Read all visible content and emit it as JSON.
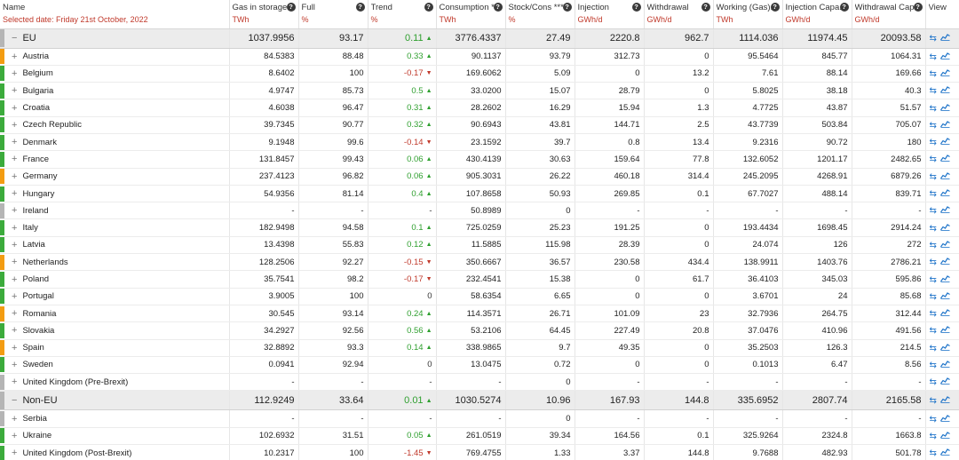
{
  "header": {
    "name_title": "Name",
    "selected_date": "Selected date: Friday 21st October, 2022",
    "help_glyph": "?",
    "columns": [
      {
        "key": "gas",
        "title": "Gas in storage",
        "unit": "TWh"
      },
      {
        "key": "full",
        "title": "Full",
        "unit": "%"
      },
      {
        "key": "trend",
        "title": "Trend",
        "unit": "%"
      },
      {
        "key": "cons",
        "title": "Consumption **",
        "unit": "TWh"
      },
      {
        "key": "stock",
        "title": "Stock/Cons ***",
        "unit": "%"
      },
      {
        "key": "inj",
        "title": "Injection",
        "unit": "GWh/d"
      },
      {
        "key": "wd",
        "title": "Withdrawal",
        "unit": "GWh/d"
      },
      {
        "key": "work",
        "title": "Working (Gas)...",
        "unit": "TWh"
      },
      {
        "key": "injc",
        "title": "Injection Capa...",
        "unit": "GWh/d"
      },
      {
        "key": "wdc",
        "title": "Withdrawal Cap...",
        "unit": "GWh/d"
      }
    ],
    "view_title": "View"
  },
  "icons": {
    "expand_collapsed": "+",
    "expand_open": "−",
    "trend_up": "▲",
    "trend_down": "▼",
    "map_view": "⇆",
    "chart_view": "📈"
  },
  "colors": {
    "green": "#3cab3c",
    "orange": "#f39c12",
    "gray": "#b5b5b5",
    "trend_up": "#2e9f2e",
    "trend_down": "#c0392b"
  },
  "rows": [
    {
      "type": "group",
      "name": "EU",
      "bar": "gray",
      "gas": "1037.9956",
      "full": "93.17",
      "trend": "0.11",
      "dir": "up",
      "cons": "3776.4337",
      "stock": "27.49",
      "inj": "2220.8",
      "wd": "962.7",
      "work": "1114.036",
      "injc": "11974.45",
      "wdc": "20093.58"
    },
    {
      "type": "country",
      "name": "Austria",
      "bar": "orange",
      "gas": "84.5383",
      "full": "88.48",
      "trend": "0.33",
      "dir": "up",
      "cons": "90.1137",
      "stock": "93.79",
      "inj": "312.73",
      "wd": "0",
      "work": "95.5464",
      "injc": "845.77",
      "wdc": "1064.31"
    },
    {
      "type": "country",
      "name": "Belgium",
      "bar": "green",
      "gas": "8.6402",
      "full": "100",
      "trend": "-0.17",
      "dir": "down",
      "cons": "169.6062",
      "stock": "5.09",
      "inj": "0",
      "wd": "13.2",
      "work": "7.61",
      "injc": "88.14",
      "wdc": "169.66"
    },
    {
      "type": "country",
      "name": "Bulgaria",
      "bar": "green",
      "gas": "4.9747",
      "full": "85.73",
      "trend": "0.5",
      "dir": "up",
      "cons": "33.0200",
      "stock": "15.07",
      "inj": "28.79",
      "wd": "0",
      "work": "5.8025",
      "injc": "38.18",
      "wdc": "40.3"
    },
    {
      "type": "country",
      "name": "Croatia",
      "bar": "green",
      "gas": "4.6038",
      "full": "96.47",
      "trend": "0.31",
      "dir": "up",
      "cons": "28.2602",
      "stock": "16.29",
      "inj": "15.94",
      "wd": "1.3",
      "work": "4.7725",
      "injc": "43.87",
      "wdc": "51.57"
    },
    {
      "type": "country",
      "name": "Czech Republic",
      "bar": "green",
      "gas": "39.7345",
      "full": "90.77",
      "trend": "0.32",
      "dir": "up",
      "cons": "90.6943",
      "stock": "43.81",
      "inj": "144.71",
      "wd": "2.5",
      "work": "43.7739",
      "injc": "503.84",
      "wdc": "705.07"
    },
    {
      "type": "country",
      "name": "Denmark",
      "bar": "green",
      "gas": "9.1948",
      "full": "99.6",
      "trend": "-0.14",
      "dir": "down",
      "cons": "23.1592",
      "stock": "39.7",
      "inj": "0.8",
      "wd": "13.4",
      "work": "9.2316",
      "injc": "90.72",
      "wdc": "180"
    },
    {
      "type": "country",
      "name": "France",
      "bar": "green",
      "gas": "131.8457",
      "full": "99.43",
      "trend": "0.06",
      "dir": "up",
      "cons": "430.4139",
      "stock": "30.63",
      "inj": "159.64",
      "wd": "77.8",
      "work": "132.6052",
      "injc": "1201.17",
      "wdc": "2482.65"
    },
    {
      "type": "country",
      "name": "Germany",
      "bar": "orange",
      "gas": "237.4123",
      "full": "96.82",
      "trend": "0.06",
      "dir": "up",
      "cons": "905.3031",
      "stock": "26.22",
      "inj": "460.18",
      "wd": "314.4",
      "work": "245.2095",
      "injc": "4268.91",
      "wdc": "6879.26"
    },
    {
      "type": "country",
      "name": "Hungary",
      "bar": "green",
      "gas": "54.9356",
      "full": "81.14",
      "trend": "0.4",
      "dir": "up",
      "cons": "107.8658",
      "stock": "50.93",
      "inj": "269.85",
      "wd": "0.1",
      "work": "67.7027",
      "injc": "488.14",
      "wdc": "839.71"
    },
    {
      "type": "country",
      "name": "Ireland",
      "bar": "gray",
      "gas": "-",
      "full": "-",
      "trend": "-",
      "dir": "none",
      "cons": "50.8989",
      "stock": "0",
      "inj": "-",
      "wd": "-",
      "work": "-",
      "injc": "-",
      "wdc": "-"
    },
    {
      "type": "country",
      "name": "Italy",
      "bar": "green",
      "gas": "182.9498",
      "full": "94.58",
      "trend": "0.1",
      "dir": "up",
      "cons": "725.0259",
      "stock": "25.23",
      "inj": "191.25",
      "wd": "0",
      "work": "193.4434",
      "injc": "1698.45",
      "wdc": "2914.24"
    },
    {
      "type": "country",
      "name": "Latvia",
      "bar": "green",
      "gas": "13.4398",
      "full": "55.83",
      "trend": "0.12",
      "dir": "up",
      "cons": "11.5885",
      "stock": "115.98",
      "inj": "28.39",
      "wd": "0",
      "work": "24.074",
      "injc": "126",
      "wdc": "272"
    },
    {
      "type": "country",
      "name": "Netherlands",
      "bar": "orange",
      "gas": "128.2506",
      "full": "92.27",
      "trend": "-0.15",
      "dir": "down",
      "cons": "350.6667",
      "stock": "36.57",
      "inj": "230.58",
      "wd": "434.4",
      "work": "138.9911",
      "injc": "1403.76",
      "wdc": "2786.21"
    },
    {
      "type": "country",
      "name": "Poland",
      "bar": "green",
      "gas": "35.7541",
      "full": "98.2",
      "trend": "-0.17",
      "dir": "down",
      "cons": "232.4541",
      "stock": "15.38",
      "inj": "0",
      "wd": "61.7",
      "work": "36.4103",
      "injc": "345.03",
      "wdc": "595.86"
    },
    {
      "type": "country",
      "name": "Portugal",
      "bar": "green",
      "gas": "3.9005",
      "full": "100",
      "trend": "0",
      "dir": "none",
      "cons": "58.6354",
      "stock": "6.65",
      "inj": "0",
      "wd": "0",
      "work": "3.6701",
      "injc": "24",
      "wdc": "85.68"
    },
    {
      "type": "country",
      "name": "Romania",
      "bar": "orange",
      "gas": "30.545",
      "full": "93.14",
      "trend": "0.24",
      "dir": "up",
      "cons": "114.3571",
      "stock": "26.71",
      "inj": "101.09",
      "wd": "23",
      "work": "32.7936",
      "injc": "264.75",
      "wdc": "312.44"
    },
    {
      "type": "country",
      "name": "Slovakia",
      "bar": "green",
      "gas": "34.2927",
      "full": "92.56",
      "trend": "0.56",
      "dir": "up",
      "cons": "53.2106",
      "stock": "64.45",
      "inj": "227.49",
      "wd": "20.8",
      "work": "37.0476",
      "injc": "410.96",
      "wdc": "491.56"
    },
    {
      "type": "country",
      "name": "Spain",
      "bar": "orange",
      "gas": "32.8892",
      "full": "93.3",
      "trend": "0.14",
      "dir": "up",
      "cons": "338.9865",
      "stock": "9.7",
      "inj": "49.35",
      "wd": "0",
      "work": "35.2503",
      "injc": "126.3",
      "wdc": "214.5"
    },
    {
      "type": "country",
      "name": "Sweden",
      "bar": "green",
      "gas": "0.0941",
      "full": "92.94",
      "trend": "0",
      "dir": "none",
      "cons": "13.0475",
      "stock": "0.72",
      "inj": "0",
      "wd": "0",
      "work": "0.1013",
      "injc": "6.47",
      "wdc": "8.56"
    },
    {
      "type": "country",
      "name": "United Kingdom (Pre-Brexit)",
      "bar": "gray",
      "gas": "-",
      "full": "-",
      "trend": "-",
      "dir": "none",
      "cons": "-",
      "stock": "0",
      "inj": "-",
      "wd": "-",
      "work": "-",
      "injc": "-",
      "wdc": "-"
    },
    {
      "type": "group",
      "name": "Non-EU",
      "bar": "gray",
      "gas": "112.9249",
      "full": "33.64",
      "trend": "0.01",
      "dir": "up",
      "cons": "1030.5274",
      "stock": "10.96",
      "inj": "167.93",
      "wd": "144.8",
      "work": "335.6952",
      "injc": "2807.74",
      "wdc": "2165.58"
    },
    {
      "type": "country",
      "name": "Serbia",
      "bar": "gray",
      "gas": "-",
      "full": "-",
      "trend": "-",
      "dir": "none",
      "cons": "-",
      "stock": "0",
      "inj": "-",
      "wd": "-",
      "work": "-",
      "injc": "-",
      "wdc": "-"
    },
    {
      "type": "country",
      "name": "Ukraine",
      "bar": "green",
      "gas": "102.6932",
      "full": "31.51",
      "trend": "0.05",
      "dir": "up",
      "cons": "261.0519",
      "stock": "39.34",
      "inj": "164.56",
      "wd": "0.1",
      "work": "325.9264",
      "injc": "2324.8",
      "wdc": "1663.8"
    },
    {
      "type": "country",
      "name": "United Kingdom (Post-Brexit)",
      "bar": "green",
      "gas": "10.2317",
      "full": "100",
      "trend": "-1.45",
      "dir": "down",
      "cons": "769.4755",
      "stock": "1.33",
      "inj": "3.37",
      "wd": "144.8",
      "work": "9.7688",
      "injc": "482.93",
      "wdc": "501.78"
    }
  ]
}
